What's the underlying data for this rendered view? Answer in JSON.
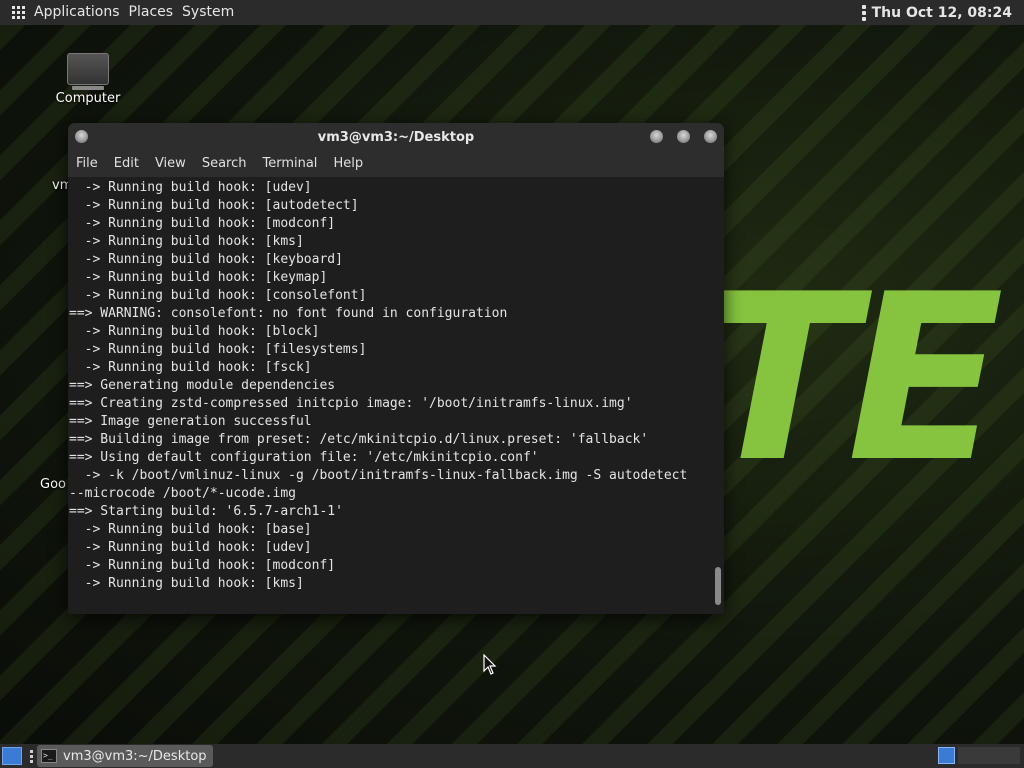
{
  "top_panel": {
    "menus": [
      "Applications",
      "Places",
      "System"
    ],
    "clock": "Thu Oct 12, 08:24"
  },
  "desktop": {
    "icons": [
      {
        "label": "Computer",
        "icon": "computer-icon"
      }
    ],
    "partial_labels": [
      "vm",
      "Goo"
    ],
    "wallpaper_text": "TE"
  },
  "terminal": {
    "title": "vm3@vm3:~/Desktop",
    "menu": [
      "File",
      "Edit",
      "View",
      "Search",
      "Terminal",
      "Help"
    ],
    "lines": [
      "  -> Running build hook: [udev]",
      "  -> Running build hook: [autodetect]",
      "  -> Running build hook: [modconf]",
      "  -> Running build hook: [kms]",
      "  -> Running build hook: [keyboard]",
      "  -> Running build hook: [keymap]",
      "  -> Running build hook: [consolefont]",
      "==> WARNING: consolefont: no font found in configuration",
      "  -> Running build hook: [block]",
      "  -> Running build hook: [filesystems]",
      "  -> Running build hook: [fsck]",
      "==> Generating module dependencies",
      "==> Creating zstd-compressed initcpio image: '/boot/initramfs-linux.img'",
      "==> Image generation successful",
      "==> Building image from preset: /etc/mkinitcpio.d/linux.preset: 'fallback'",
      "==> Using default configuration file: '/etc/mkinitcpio.conf'",
      "  -> -k /boot/vmlinuz-linux -g /boot/initramfs-linux-fallback.img -S autodetect",
      "--microcode /boot/*-ucode.img",
      "==> Starting build: '6.5.7-arch1-1'",
      "  -> Running build hook: [base]",
      "  -> Running build hook: [udev]",
      "  -> Running build hook: [modconf]",
      "  -> Running build hook: [kms]"
    ]
  },
  "taskbar": {
    "window_button": "vm3@vm3:~/Desktop",
    "terminal_icon_glyph": ">_"
  },
  "colors": {
    "panel_bg": "#2b2b2b",
    "terminal_bg": "#1e1e1e",
    "wallpaper_accent": "#86c440",
    "workspace_active": "#3b7bd4"
  }
}
